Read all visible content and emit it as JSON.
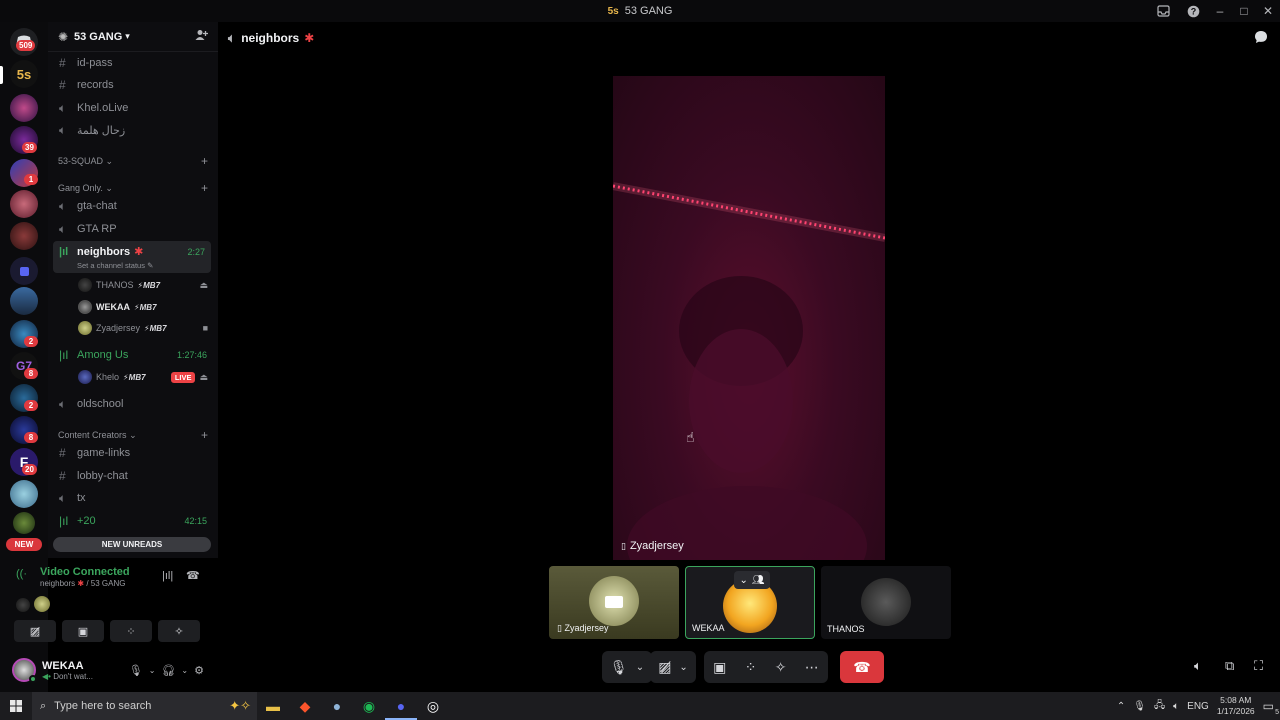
{
  "window": {
    "title": "53 GANG",
    "server_icon_text": "5s"
  },
  "rail": {
    "home_badge": "509",
    "server_badges": [
      "39",
      "1",
      "2",
      "8",
      "2",
      "8",
      "20"
    ],
    "new_pill": "NEW"
  },
  "server": {
    "name": "53 GANG",
    "channels_top": [
      "id-pass",
      "records",
      "Khel.oLive",
      "زحال هلمة"
    ],
    "category_squad": "53-SQUAD",
    "category_gang": "Gang Only.",
    "gang_channels": [
      "gta-chat",
      "GTA RP"
    ],
    "active_channel": {
      "name": "neighbors",
      "timer": "2:27",
      "status_prompt": "Set a channel status"
    },
    "voice_users": [
      {
        "name": "THANOS",
        "tag": "MB7"
      },
      {
        "name": "WEKAA",
        "tag": "MB7"
      },
      {
        "name": "Zyadjersey",
        "tag": "MB7"
      }
    ],
    "among_us": {
      "name": "Among Us",
      "timer": "1:27:46"
    },
    "among_us_user": {
      "name": "Khelo",
      "tag": "MB7",
      "live": "LIVE"
    },
    "oldschool": "oldschool",
    "category_creators": "Content Creators",
    "creator_channels": [
      "game-links",
      "lobby-chat",
      "tx"
    ],
    "more_voice": {
      "name": "+20",
      "timer": "42:15"
    },
    "new_unreads": "NEW UNREADS"
  },
  "voice_panel": {
    "status": "Video Connected",
    "location_channel": "neighbors",
    "location_server": "/ 53 GANG"
  },
  "user_panel": {
    "name": "WEKAA",
    "status": "Don't wat..."
  },
  "main": {
    "channel_name": "neighbors",
    "video_user": "Zyadjersey",
    "tiles": [
      {
        "name": "Zyadjersey"
      },
      {
        "name": "WEKAA"
      },
      {
        "name": "THANOS"
      }
    ]
  },
  "taskbar": {
    "search_placeholder": "Type here to search",
    "lang": "ENG",
    "time": "5:08 AM",
    "date": "1/17/2026",
    "notif_count": "5"
  },
  "colors": {
    "accent_green": "#3ba55d",
    "danger_red": "#da373c",
    "brand": "#5865f2",
    "live_red": "#ed4245"
  }
}
